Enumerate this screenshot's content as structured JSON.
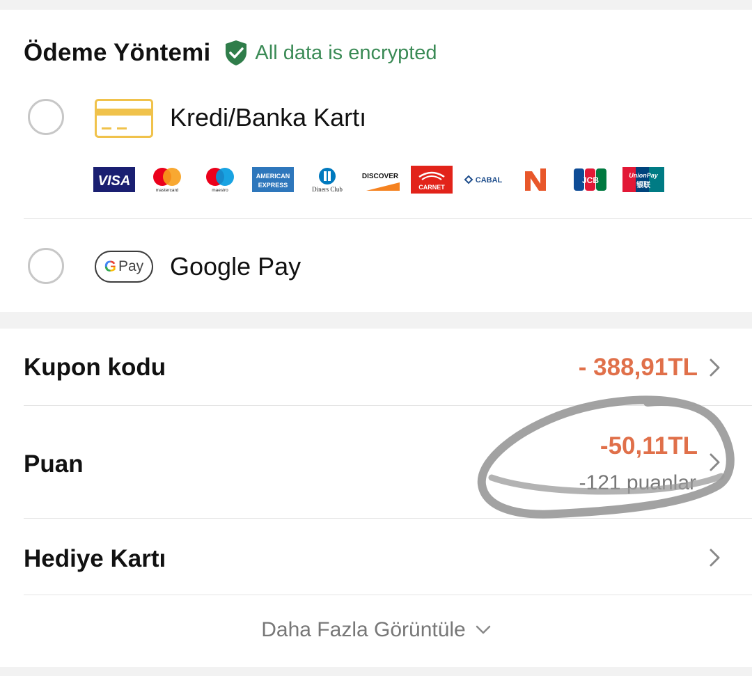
{
  "payment": {
    "title": "Ödeme Yöntemi",
    "encrypted_text": "All data is encrypted",
    "methods": [
      {
        "label": "Kredi/Banka Kartı",
        "icon": "credit-card-icon",
        "selected": false
      },
      {
        "label": "Google Pay",
        "icon": "google-pay-icon",
        "badge_text": "Pay",
        "selected": false
      }
    ],
    "brands": [
      {
        "name": "VISA"
      },
      {
        "name": "mastercard"
      },
      {
        "name": "maestro"
      },
      {
        "name": "AMERICAN EXPRESS"
      },
      {
        "name": "Diners Club"
      },
      {
        "name": "DISCOVER"
      },
      {
        "name": "CARNET"
      },
      {
        "name": "CABAL"
      },
      {
        "name": "N"
      },
      {
        "name": "JCB"
      },
      {
        "name": "UnionPay 银联"
      }
    ]
  },
  "discounts": {
    "coupon": {
      "label": "Kupon kodu",
      "value": "- 388,91TL"
    },
    "points": {
      "label": "Puan",
      "value": "-50,11TL",
      "sub": "-121 puanlar"
    },
    "gift_card": {
      "label": "Hediye Kartı"
    },
    "more": {
      "label": "Daha Fazla Görüntüle"
    }
  },
  "colors": {
    "accent_orange": "#e0704a",
    "encrypted_green": "#3a8a55",
    "card_icon_yellow": "#f0c24b"
  }
}
